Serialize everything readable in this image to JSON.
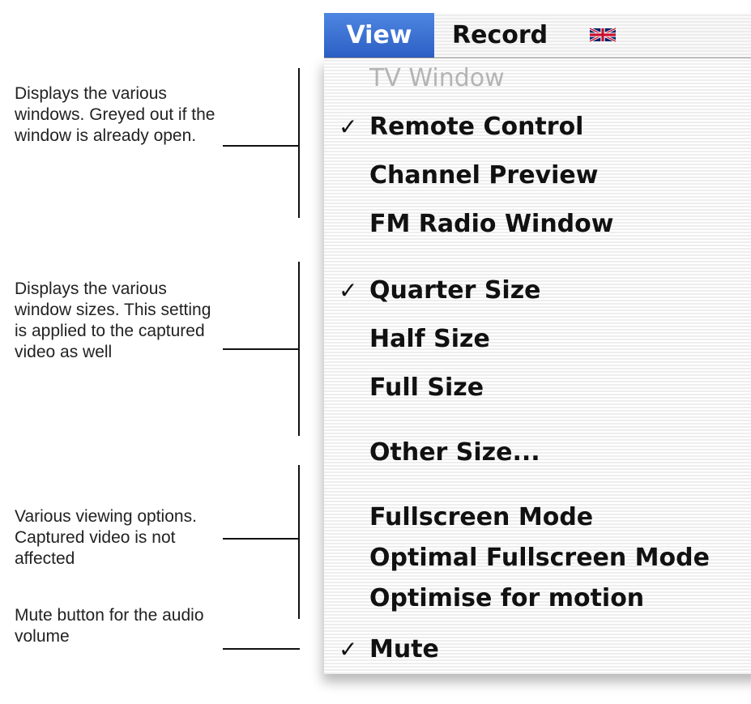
{
  "annotations": [
    {
      "text": "Displays the various windows. Greyed out if the window is already open."
    },
    {
      "text": "Displays the various window sizes. This setting is applied to the captured video as well"
    },
    {
      "text": "Various viewing options. Captured video is not affected"
    },
    {
      "text": "Mute button for the audio volume"
    }
  ],
  "menubar": {
    "items": [
      {
        "label": "View",
        "selected": true
      },
      {
        "label": "Record"
      }
    ],
    "flag_icon": "uk-flag-icon",
    "accent_color": "#3a6fd6"
  },
  "menu": {
    "items": [
      {
        "label": "TV Window",
        "enabled": false,
        "checked": false
      },
      {
        "label": "Remote Control",
        "enabled": true,
        "checked": true,
        "check": "✓"
      },
      {
        "label": "Channel Preview",
        "enabled": true,
        "checked": false
      },
      {
        "label": "FM Radio Window",
        "enabled": true,
        "checked": false
      },
      {
        "label": "Quarter Size",
        "enabled": true,
        "checked": true,
        "check": "✓"
      },
      {
        "label": "Half Size",
        "enabled": true,
        "checked": false
      },
      {
        "label": "Full Size",
        "enabled": true,
        "checked": false
      },
      {
        "label": "Other Size...",
        "enabled": true,
        "checked": false
      },
      {
        "label": "Fullscreen Mode",
        "enabled": true,
        "checked": false
      },
      {
        "label": "Optimal Fullscreen Mode",
        "enabled": true,
        "checked": false
      },
      {
        "label": "Optimise for motion",
        "enabled": true,
        "checked": false
      },
      {
        "label": "Mute",
        "enabled": true,
        "checked": true,
        "check": "✓"
      }
    ]
  }
}
